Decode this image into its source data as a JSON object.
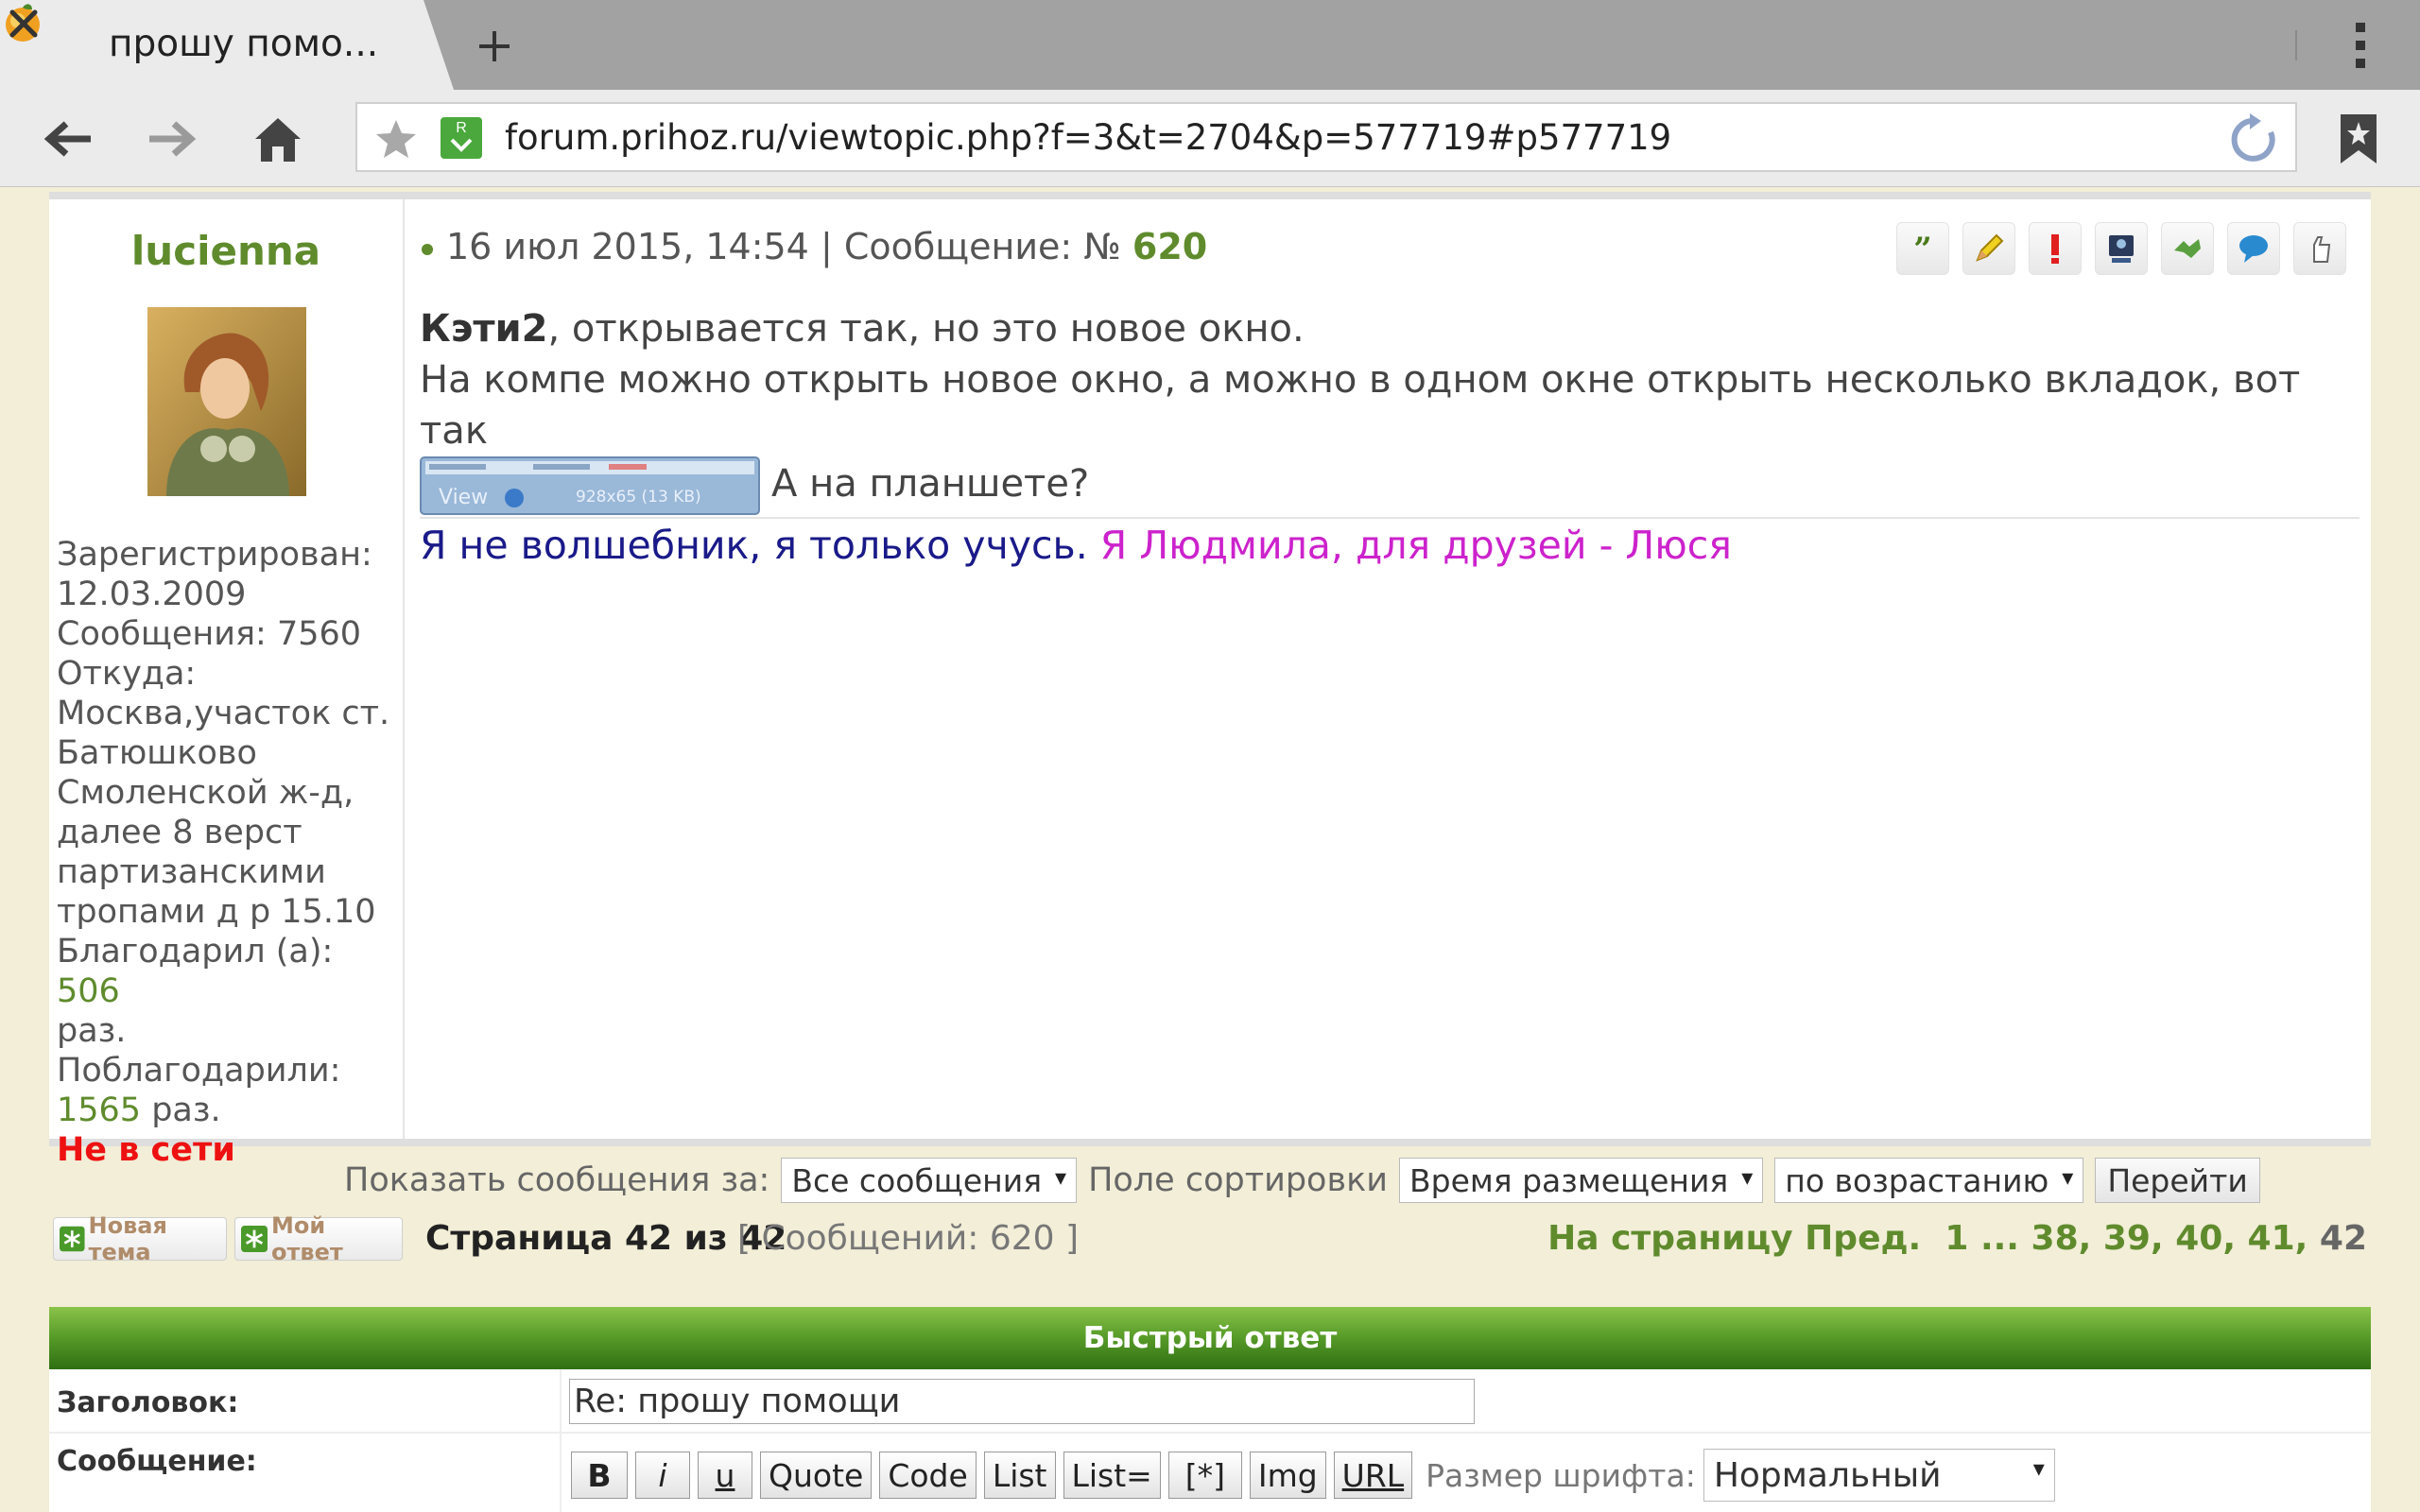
{
  "browser": {
    "tab_title": "прошу помо...",
    "url": "forum.prihoz.ru/viewtopic.php?f=3&t=2704&p=577719#p577719"
  },
  "profile": {
    "username": "lucienna",
    "registered_label": "Зарегистрирован:",
    "registered_date": "12.03.2009",
    "posts_label": "Сообщения:",
    "posts_count": "7560",
    "location_label": "Откуда:",
    "location_lines": [
      "Москва,участок ст.",
      "Батюшково",
      "Смоленской ж-д,",
      "далее 8 верст",
      "партизанскими",
      "тропами д р 15.10"
    ],
    "thanked_label": "Благодарил (а):",
    "thanked_count": "506",
    "thanked_suffix": "раз.",
    "was_thanked_label": "Поблагодарили:",
    "was_thanked_count": "1565",
    "was_thanked_suffix": "раз.",
    "status": "Не в сети"
  },
  "post": {
    "date": "16 июл 2015, 14:54",
    "message_label": "| Сообщение: №",
    "number": "620",
    "action_icons": [
      "quote-icon",
      "edit-icon",
      "report-icon",
      "info-icon",
      "thanks-icon",
      "pm-icon",
      "warn-icon"
    ],
    "mention": "Кэти2",
    "line1_rest": ", открывается так, но это новое окно.",
    "line2": "На компе можно открыть новое окно, а можно в одном окне открыть несколько вкладок, вот так",
    "thumb_view": "View",
    "thumb_size": "928x65 (13 KB)",
    "line3": "А на планшете?",
    "signature_a": "Я не волшебник, я только учусь.",
    "signature_b": "Я Людмила, для друзей - Люся"
  },
  "filter": {
    "show_label": "Показать сообщения за:",
    "show_value": "Все сообщения",
    "sort_label": "Поле сортировки",
    "sort_value": "Время размещения",
    "order_value": "по возрастанию",
    "go_label": "Перейти"
  },
  "pager": {
    "new_topic": "Новая тема",
    "reply": "Мой ответ",
    "page_info": "Страница 42 из 42",
    "msg_count": "[ Сообщений: 620 ]",
    "goto_label": "На страницу",
    "prev_label": "Пред.",
    "first": "1",
    "ellipsis": "...",
    "p38": "38",
    "p39": "39",
    "p40": "40",
    "p41": "41",
    "current": "42"
  },
  "quick_reply": {
    "header": "Быстрый ответ",
    "subject_label": "Заголовок:",
    "subject_value": "Re: прошу помощи",
    "message_label": "Сообщение:",
    "format_buttons": [
      "B",
      "i",
      "u",
      "Quote",
      "Code",
      "List",
      "List=",
      "[*]",
      "Img",
      "URL"
    ],
    "font_size_label": "Размер шрифта:",
    "font_size_value": "Нормальный"
  },
  "colors": {
    "accent_green": "#5f8b2d",
    "offline_red": "#ee1111",
    "signature_blue": "#1a1a8a",
    "signature_magenta": "#cc22cc",
    "page_bg": "#f2eed7"
  }
}
